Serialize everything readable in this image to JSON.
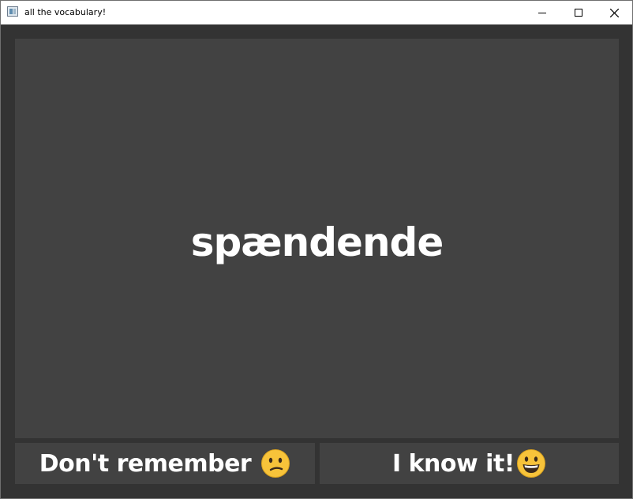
{
  "window": {
    "title": "all the vocabulary!"
  },
  "card": {
    "word": "spændende"
  },
  "buttons": {
    "dont_remember": "Don't remember",
    "know_it": "I know it!"
  },
  "icons": {
    "dont_remember_emoji": "confused-face-icon",
    "know_it_emoji": "grinning-face-icon"
  },
  "colors": {
    "background": "#333333",
    "card": "#424242",
    "text": "#ffffff",
    "emoji_face": "#f7c33a"
  }
}
